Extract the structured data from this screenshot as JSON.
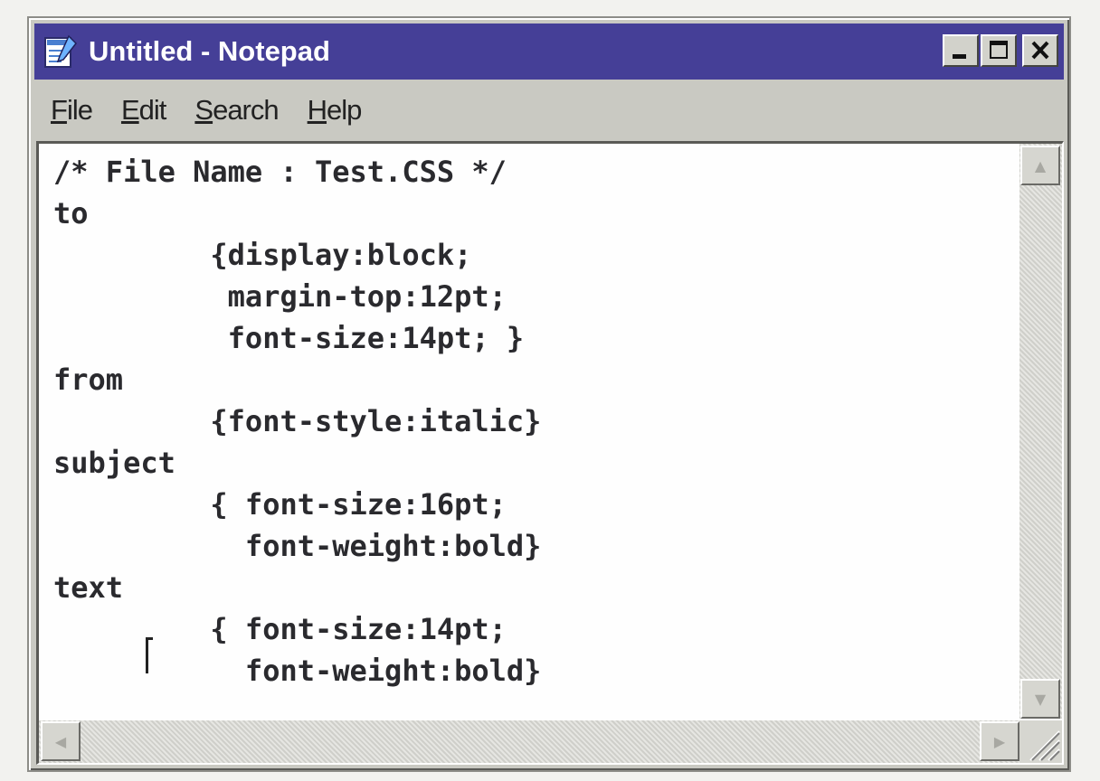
{
  "window": {
    "title": "Untitled - Notepad",
    "titlebar_color": "#453f97",
    "buttons": [
      "minimize-icon",
      "maximize-icon",
      "close-icon"
    ]
  },
  "menu": {
    "items": [
      {
        "accel": "F",
        "rest": "ile"
      },
      {
        "accel": "E",
        "rest": "dit"
      },
      {
        "accel": "S",
        "rest": "earch"
      },
      {
        "accel": "H",
        "rest": "elp"
      }
    ]
  },
  "editor": {
    "content": "/* File Name : Test.CSS */\nto\n         {display:block;\n          margin-top:12pt;\n          font-size:14pt; }\nfrom\n         {font-style:italic}\nsubject\n         { font-size:16pt;\n           font-weight:bold}\ntext\n         { font-size:14pt;\n           font-weight:bold}"
  }
}
